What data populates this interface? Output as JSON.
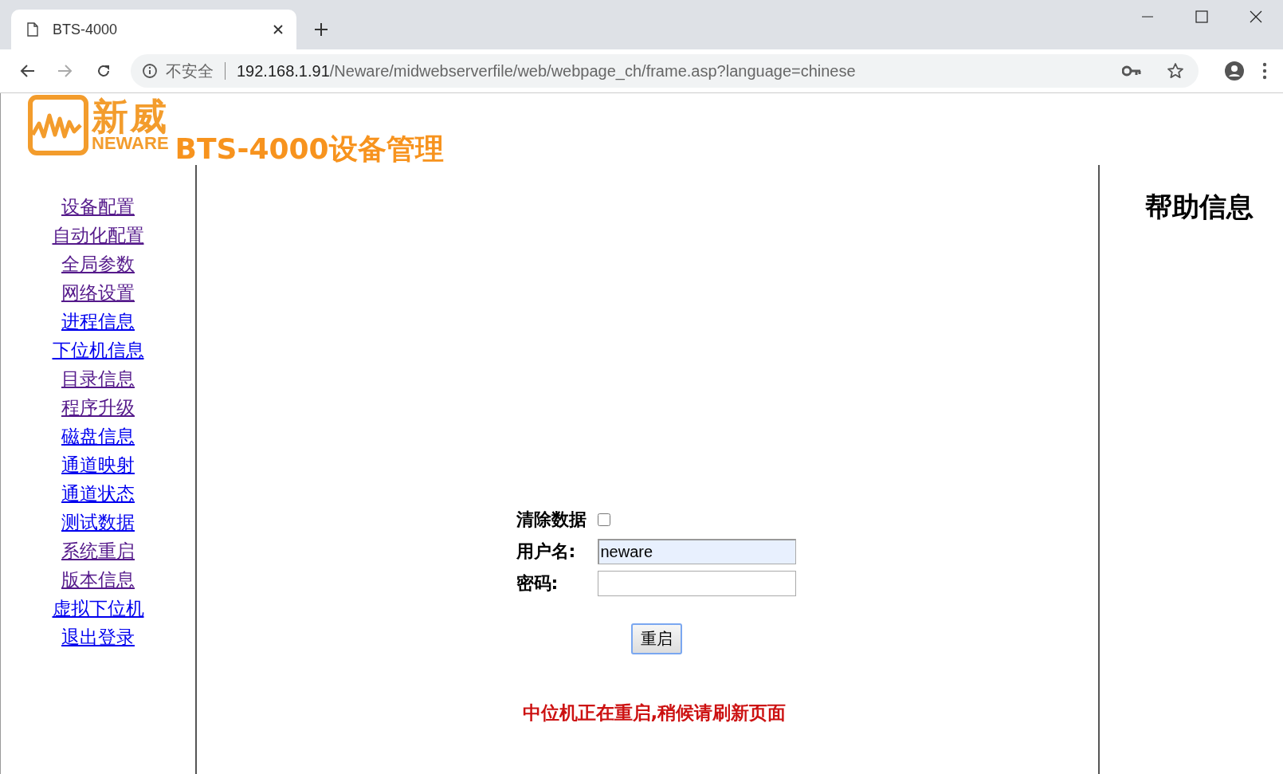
{
  "browser": {
    "tab_title": "BTS-4000",
    "security_label": "不安全",
    "url_host": "192.168.1.91",
    "url_path": "/Neware/midwebserverfile/web/webpage_ch/frame.asp?language=chinese"
  },
  "header": {
    "logo_cn": "新威",
    "logo_en": "NEWARE",
    "title": "BTS-4000设备管理"
  },
  "sidebar": {
    "items": [
      {
        "label": "设备配置",
        "visited": true
      },
      {
        "label": "自动化配置",
        "visited": true
      },
      {
        "label": "全局参数",
        "visited": true
      },
      {
        "label": "网络设置",
        "visited": true
      },
      {
        "label": "进程信息",
        "visited": false
      },
      {
        "label": "下位机信息",
        "visited": false
      },
      {
        "label": "目录信息",
        "visited": true
      },
      {
        "label": "程序升级",
        "visited": true
      },
      {
        "label": "磁盘信息",
        "visited": false
      },
      {
        "label": "通道映射",
        "visited": false
      },
      {
        "label": "通道状态",
        "visited": false
      },
      {
        "label": "测试数据",
        "visited": false
      },
      {
        "label": "系统重启",
        "visited": true
      },
      {
        "label": "版本信息",
        "visited": true
      },
      {
        "label": "虚拟下位机",
        "visited": false
      },
      {
        "label": "退出登录",
        "visited": false
      }
    ]
  },
  "form": {
    "clear_data_label": "清除数据",
    "clear_data_checked": false,
    "username_label": "用户名:",
    "username_value": "neware",
    "password_label": "密码:",
    "submit": "重启",
    "message": "中位机正在重启,稍候请刷新页面"
  },
  "help": {
    "title": "帮助信息"
  }
}
